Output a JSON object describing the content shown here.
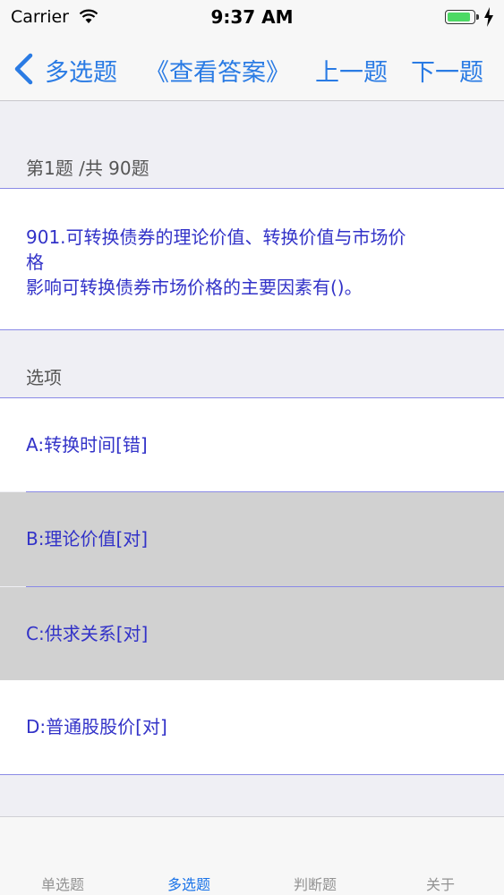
{
  "status_bar": {
    "carrier": "Carrier",
    "time": "9:37 AM"
  },
  "nav": {
    "back_label": "多选题",
    "title": "《查看答案》",
    "prev_label": "上一题",
    "next_label": "下一题"
  },
  "question": {
    "counter": "第1题 /共 90题",
    "line1": "901.可转换债券的理论价值、转换价值与市场价",
    "line2": "格",
    "line3": "影响可转换债券市场价格的主要因素有()。"
  },
  "options_header": "选项",
  "options": [
    {
      "label": "A:转换时间[错]",
      "selected": false
    },
    {
      "label": "B:理论价值[对]",
      "selected": true
    },
    {
      "label": "C:供求关系[对]",
      "selected": true
    },
    {
      "label": "D:普通股股价[对]",
      "selected": false
    }
  ],
  "tabs": [
    {
      "label": "单选题",
      "active": false
    },
    {
      "label": "多选题",
      "active": true
    },
    {
      "label": "判断题",
      "active": false
    },
    {
      "label": "关于",
      "active": false
    }
  ],
  "colors": {
    "accent": "#1a73e8",
    "option_text": "#3232c8",
    "selected_bg": "#d1d1d1"
  }
}
